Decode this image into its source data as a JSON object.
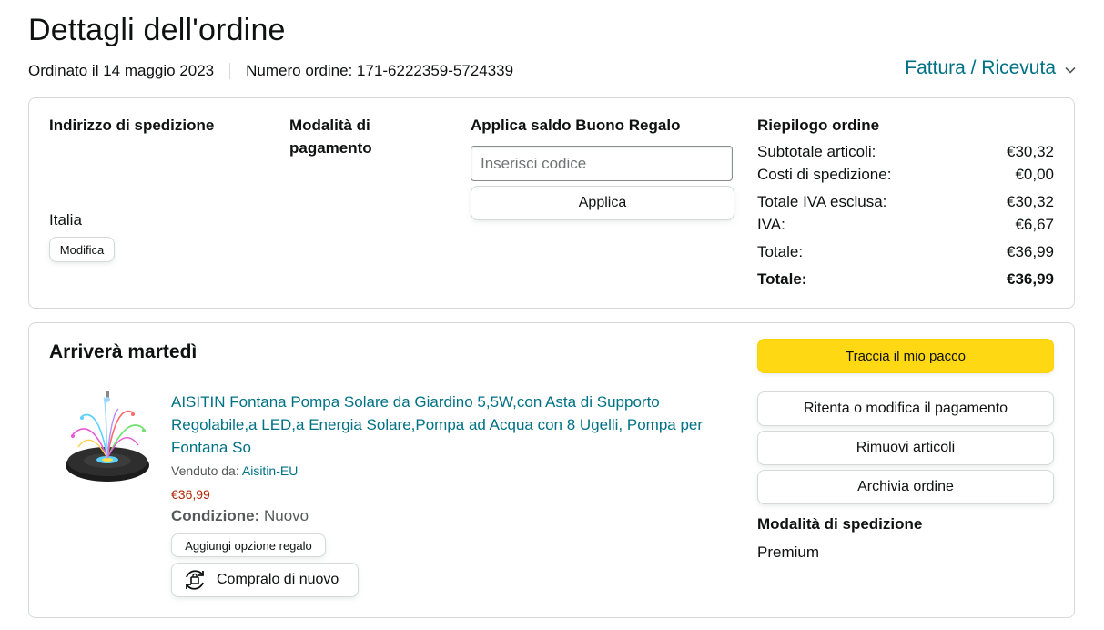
{
  "header": {
    "title": "Dettagli dell'ordine",
    "ordered_on": "Ordinato il 14 maggio 2023",
    "order_number": "Numero ordine: 171-6222359-5724339",
    "invoice_link": "Fattura / Ricevuta",
    "invoice_icon": "chevron-down-icon"
  },
  "shipping_address": {
    "heading": "Indirizzo di spedizione",
    "country": "Italia",
    "edit_button": "Modifica"
  },
  "payment": {
    "heading": "Modalità di pagamento"
  },
  "gift_card": {
    "heading": "Applica saldo Buono Regalo",
    "input_placeholder": "Inserisci codice",
    "input_value": "",
    "apply_button": "Applica"
  },
  "summary": {
    "heading": "Riepilogo ordine",
    "rows": [
      {
        "label": "Subtotale articoli:",
        "value": "€30,32"
      },
      {
        "label": "Costi di spedizione:",
        "value": "€0,00"
      },
      {
        "label": "Totale IVA esclusa:",
        "value": "€30,32"
      },
      {
        "label": "IVA:",
        "value": "€6,67"
      },
      {
        "label": "Totale:",
        "value": "€36,99"
      },
      {
        "label": "Totale:",
        "value": "€36,99"
      }
    ]
  },
  "shipment": {
    "heading": "Arriverà martedì",
    "product_title": "AISITIN Fontana Pompa Solare da Giardino 5,5W,con Asta di Supporto Regolabile,a LED,a Energia Solare,Pompa ad Acqua con 8 Ugelli, Pompa per Fontana So",
    "sold_by_label": "Venduto da:",
    "seller": "Aisitin-EU",
    "price": "€36,99",
    "condition_label": "Condizione:",
    "condition_value": "Nuovo",
    "gift_option_button": "Aggiungi opzione regalo",
    "buy_again_button": "Compralo di nuovo",
    "buy_again_icon": "reorder-icon"
  },
  "actions": {
    "track": "Traccia il mio pacco",
    "retry_payment": "Ritenta o modifica il pagamento",
    "remove_items": "Rimuovi articoli",
    "archive": "Archivia ordine",
    "shipping_method_heading": "Modalità di spedizione",
    "shipping_method_value": "Premium"
  },
  "colors": {
    "link": "#007185",
    "price": "#b12704",
    "primary_button": "#ffd814",
    "border": "#d5d9d9"
  }
}
